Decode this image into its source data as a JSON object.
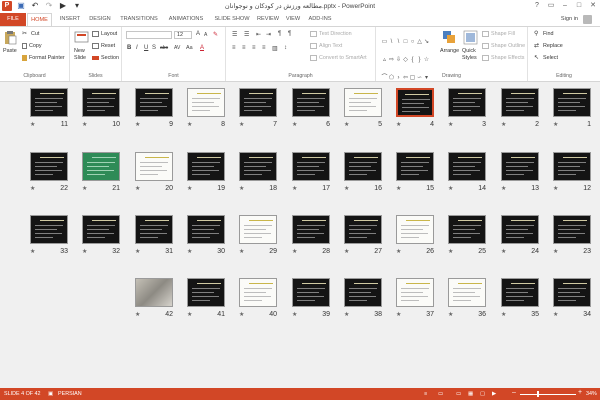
{
  "app": {
    "title": "مطالعه ورزش در کودکان و نوجوانان.pptx - PowerPoint",
    "qat_icons": [
      "save-icon",
      "undo-icon",
      "redo-icon",
      "start-from-beginning-icon",
      "customize-qat-icon"
    ]
  },
  "window_controls": [
    "?",
    "▭",
    "–",
    "□",
    "✕"
  ],
  "tabs": [
    "FILE",
    "HOME",
    "INSERT",
    "DESIGN",
    "TRANSITIONS",
    "ANIMATIONS",
    "SLIDE SHOW",
    "REVIEW",
    "VIEW",
    "ADD-INS"
  ],
  "active_tab": "HOME",
  "account": {
    "sign_in": "Sign in"
  },
  "ribbon": {
    "clipboard": {
      "label": "Clipboard",
      "paste": "Paste",
      "cut": "Cut",
      "copy": "Copy",
      "format_painter": "Format Painter"
    },
    "slides": {
      "label": "Slides",
      "new_slide": "New",
      "new_slide_2": "Slide",
      "layout": "Layout",
      "reset": "Reset",
      "section": "Section"
    },
    "font": {
      "label": "Font",
      "size": "12",
      "buttons": [
        "B",
        "I",
        "U",
        "S",
        "abc",
        "AV",
        "Aa",
        "A"
      ]
    },
    "paragraph": {
      "label": "Paragraph",
      "text_direction": "Text Direction",
      "align_text": "Align Text",
      "convert_smartart": "Convert to SmartArt"
    },
    "drawing": {
      "label": "Drawing",
      "arrange": "Arrange",
      "quick_styles": "Quick",
      "quick_styles_2": "Styles",
      "shape_fill": "Shape Fill",
      "shape_outline": "Shape Outline",
      "shape_effects": "Shape Effects"
    },
    "editing": {
      "label": "Editing",
      "find": "Find",
      "replace": "Replace",
      "select": "Select"
    }
  },
  "slides": [
    {
      "n": "1",
      "style": "dark"
    },
    {
      "n": "2",
      "style": "dark"
    },
    {
      "n": "3",
      "style": "dark"
    },
    {
      "n": "4",
      "style": "dark",
      "selected": true
    },
    {
      "n": "5",
      "style": "white"
    },
    {
      "n": "6",
      "style": "dark"
    },
    {
      "n": "7",
      "style": "dark"
    },
    {
      "n": "8",
      "style": "white"
    },
    {
      "n": "9",
      "style": "dark"
    },
    {
      "n": "10",
      "style": "dark"
    },
    {
      "n": "11",
      "style": "dark"
    },
    {
      "n": "12",
      "style": "dark"
    },
    {
      "n": "13",
      "style": "dark"
    },
    {
      "n": "14",
      "style": "dark"
    },
    {
      "n": "15",
      "style": "dark"
    },
    {
      "n": "16",
      "style": "dark"
    },
    {
      "n": "17",
      "style": "dark"
    },
    {
      "n": "18",
      "style": "dark"
    },
    {
      "n": "19",
      "style": "dark"
    },
    {
      "n": "20",
      "style": "white"
    },
    {
      "n": "21",
      "style": "green"
    },
    {
      "n": "22",
      "style": "dark"
    },
    {
      "n": "23",
      "style": "dark"
    },
    {
      "n": "24",
      "style": "dark"
    },
    {
      "n": "25",
      "style": "dark"
    },
    {
      "n": "26",
      "style": "white"
    },
    {
      "n": "27",
      "style": "dark"
    },
    {
      "n": "28",
      "style": "dark"
    },
    {
      "n": "29",
      "style": "white"
    },
    {
      "n": "30",
      "style": "dark"
    },
    {
      "n": "31",
      "style": "dark"
    },
    {
      "n": "32",
      "style": "dark"
    },
    {
      "n": "33",
      "style": "dark"
    },
    {
      "n": "34",
      "style": "dark"
    },
    {
      "n": "35",
      "style": "dark"
    },
    {
      "n": "36",
      "style": "white"
    },
    {
      "n": "37",
      "style": "white"
    },
    {
      "n": "38",
      "style": "dark"
    },
    {
      "n": "39",
      "style": "dark"
    },
    {
      "n": "40",
      "style": "white"
    },
    {
      "n": "41",
      "style": "dark"
    },
    {
      "n": "42",
      "style": "photo"
    }
  ],
  "status": {
    "slide_info": "SLIDE 4 OF 42",
    "language": "PERSIAN",
    "zoom_minus": "–",
    "zoom_plus": "+",
    "zoom": "34%",
    "zoom_level_percent": 34
  },
  "colors": {
    "accent": "#d24726",
    "workspace": "#f0f0f0"
  }
}
